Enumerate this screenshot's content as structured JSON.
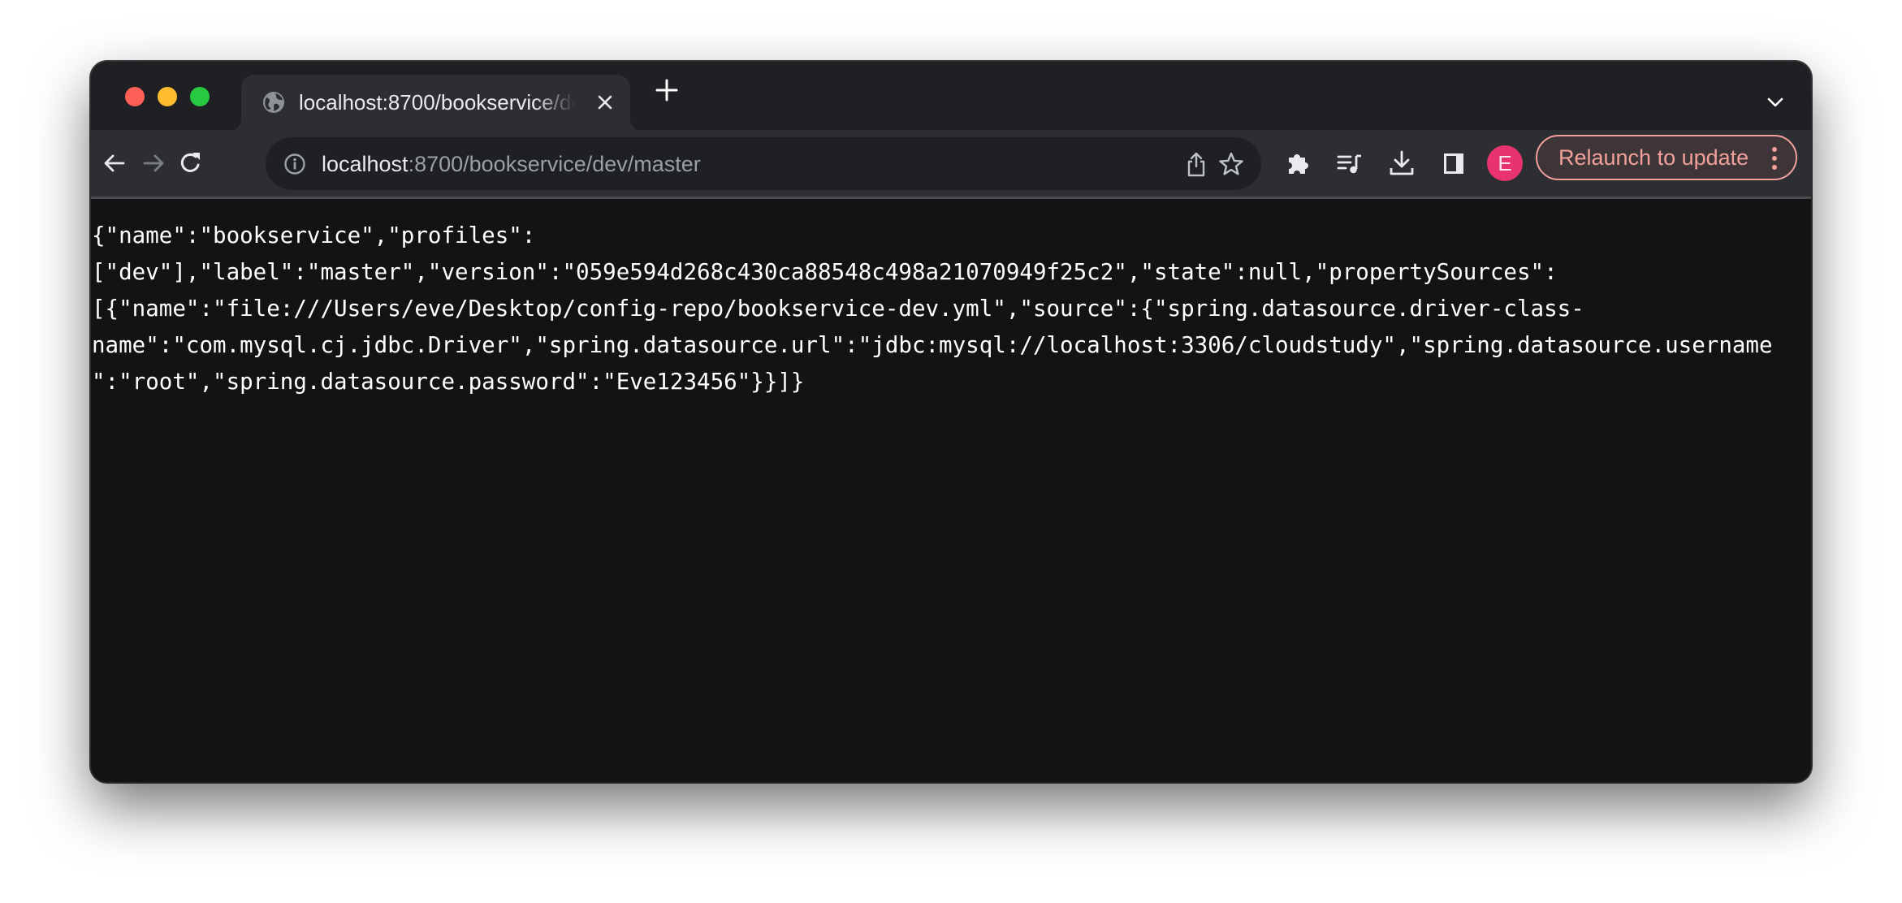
{
  "browser": {
    "tab": {
      "title": "localhost:8700/bookservice/dev/master",
      "favicon": "globe-icon"
    },
    "omnibox": {
      "host": "localhost",
      "rest": ":8700/bookservice/dev/master"
    },
    "avatar_letter": "E",
    "relaunch_label": "Relaunch to update",
    "colors": {
      "avatar": "#e8336f",
      "relaunch": "#f2a09a",
      "traffic_close": "#fe5f57",
      "traffic_minimize": "#febc2e",
      "traffic_maximize": "#28c840"
    },
    "icons": [
      "back-icon",
      "forward-icon",
      "reload-icon",
      "info-icon",
      "share-icon",
      "star-icon",
      "extensions-icon",
      "media-control-icon",
      "download-icon",
      "side-panel-icon",
      "more-vert-icon",
      "tab-search-chevron-icon",
      "new-tab-icon",
      "tab-close-icon"
    ]
  },
  "page": {
    "json_text": "{\"name\":\"bookservice\",\"profiles\":\n[\"dev\"],\"label\":\"master\",\"version\":\"059e594d268c430ca88548c498a21070949f25c2\",\"state\":null,\"propertySources\":\n[{\"name\":\"file:///Users/eve/Desktop/config-repo/bookservice-dev.yml\",\"source\":{\"spring.datasource.driver-class-\nname\":\"com.mysql.cj.jdbc.Driver\",\"spring.datasource.url\":\"jdbc:mysql://localhost:3306/cloudstudy\",\"spring.datasource.username\n\":\"root\",\"spring.datasource.password\":\"Eve123456\"}}]}"
  }
}
